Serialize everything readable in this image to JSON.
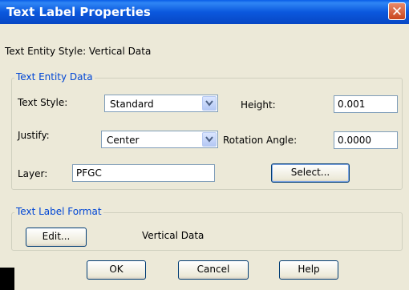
{
  "window": {
    "title": "Text Label Properties",
    "close_glyph": "✕"
  },
  "entity_style": "Text Entity Style: Vertical Data",
  "entity_data": {
    "legend": "Text Entity Data",
    "text_style_label": "Text Style:",
    "text_style_value": "Standard",
    "height_label": "Height:",
    "height_value": "0.001",
    "justify_label": "Justify:",
    "justify_value": "Center",
    "rotation_label": "Rotation Angle:",
    "rotation_value": "0.0000",
    "layer_label": "Layer:",
    "layer_value": "PFGC",
    "select_button": "Select..."
  },
  "label_format": {
    "legend": "Text Label Format",
    "edit_button": "Edit...",
    "value": "Vertical Data"
  },
  "buttons": {
    "ok": "OK",
    "cancel": "Cancel",
    "help": "Help"
  },
  "colors": {
    "titlebar": "#0b58de",
    "dialog": "#ece9d8",
    "legend": "#0046d5"
  }
}
